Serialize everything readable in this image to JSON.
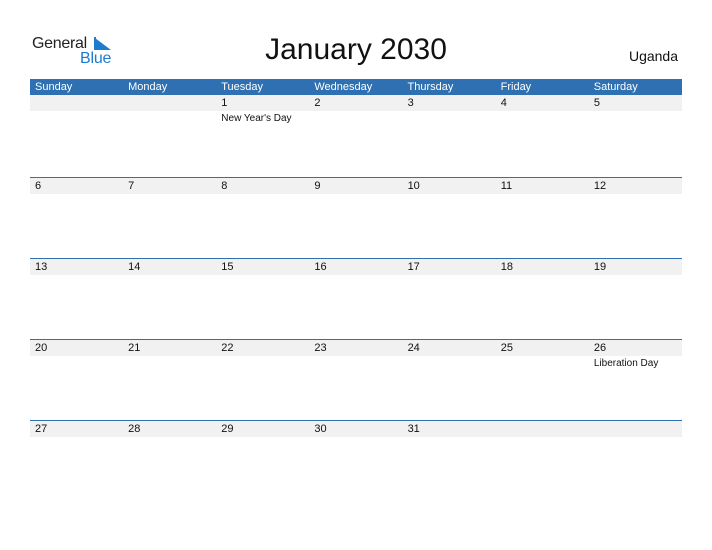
{
  "logo": {
    "general": "General",
    "blue": "Blue",
    "accent_color": "#1d7ccf"
  },
  "title": "January 2030",
  "country": "Uganda",
  "header_color": "#2e70b1",
  "weekdays": [
    "Sunday",
    "Monday",
    "Tuesday",
    "Wednesday",
    "Thursday",
    "Friday",
    "Saturday"
  ],
  "weeks": [
    [
      {
        "day": "",
        "holiday": ""
      },
      {
        "day": "",
        "holiday": ""
      },
      {
        "day": "1",
        "holiday": "New Year's Day"
      },
      {
        "day": "2",
        "holiday": ""
      },
      {
        "day": "3",
        "holiday": ""
      },
      {
        "day": "4",
        "holiday": ""
      },
      {
        "day": "5",
        "holiday": ""
      }
    ],
    [
      {
        "day": "6",
        "holiday": ""
      },
      {
        "day": "7",
        "holiday": ""
      },
      {
        "day": "8",
        "holiday": ""
      },
      {
        "day": "9",
        "holiday": ""
      },
      {
        "day": "10",
        "holiday": ""
      },
      {
        "day": "11",
        "holiday": ""
      },
      {
        "day": "12",
        "holiday": ""
      }
    ],
    [
      {
        "day": "13",
        "holiday": ""
      },
      {
        "day": "14",
        "holiday": ""
      },
      {
        "day": "15",
        "holiday": ""
      },
      {
        "day": "16",
        "holiday": ""
      },
      {
        "day": "17",
        "holiday": ""
      },
      {
        "day": "18",
        "holiday": ""
      },
      {
        "day": "19",
        "holiday": ""
      }
    ],
    [
      {
        "day": "20",
        "holiday": ""
      },
      {
        "day": "21",
        "holiday": ""
      },
      {
        "day": "22",
        "holiday": ""
      },
      {
        "day": "23",
        "holiday": ""
      },
      {
        "day": "24",
        "holiday": ""
      },
      {
        "day": "25",
        "holiday": ""
      },
      {
        "day": "26",
        "holiday": "Liberation Day"
      }
    ],
    [
      {
        "day": "27",
        "holiday": ""
      },
      {
        "day": "28",
        "holiday": ""
      },
      {
        "day": "29",
        "holiday": ""
      },
      {
        "day": "30",
        "holiday": ""
      },
      {
        "day": "31",
        "holiday": ""
      },
      {
        "day": "",
        "holiday": ""
      },
      {
        "day": "",
        "holiday": ""
      }
    ]
  ]
}
